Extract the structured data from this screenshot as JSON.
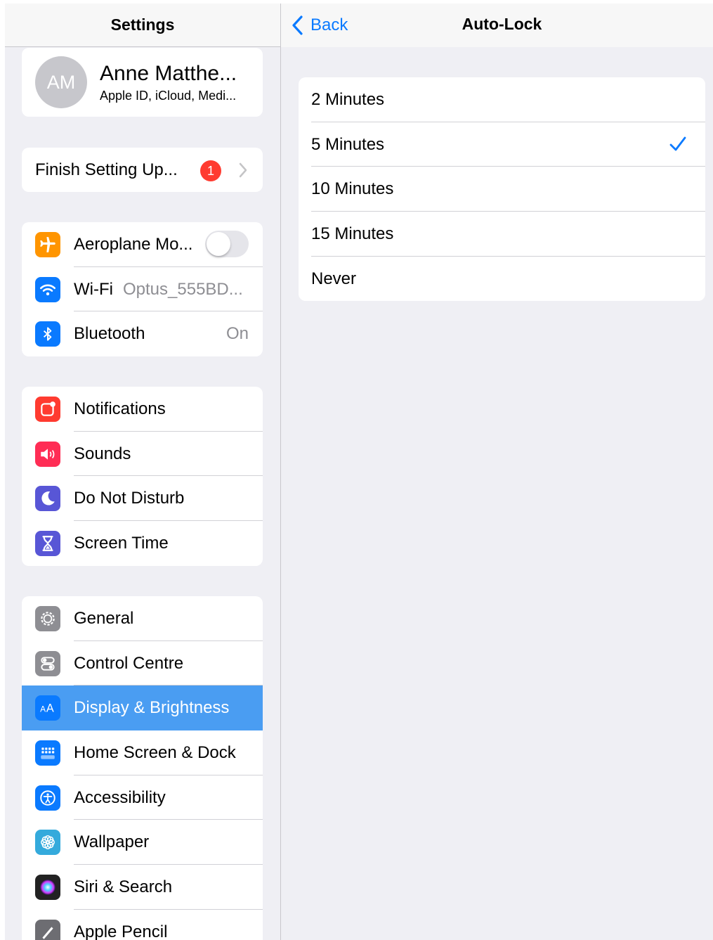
{
  "left": {
    "title": "Settings",
    "profile": {
      "initials": "AM",
      "name": "Anne Matthe...",
      "subtitle": "Apple ID, iCloud, Medi..."
    },
    "finish_setup": {
      "label": "Finish Setting Up...",
      "badge": "1"
    },
    "connectivity": [
      {
        "label": "Aeroplane Mo...",
        "icon": "airplane-icon",
        "color": "#ff9500",
        "toggle_on": false
      },
      {
        "label": "Wi-Fi",
        "value": "Optus_555BD...",
        "icon": "wifi-icon",
        "color": "#0a7aff"
      },
      {
        "label": "Bluetooth",
        "value": "On",
        "icon": "bluetooth-icon",
        "color": "#0a7aff"
      }
    ],
    "alerts": [
      {
        "label": "Notifications",
        "icon": "notifications-icon",
        "color": "#ff3b30"
      },
      {
        "label": "Sounds",
        "icon": "speaker-icon",
        "color": "#ff2d55"
      },
      {
        "label": "Do Not Disturb",
        "icon": "moon-icon",
        "color": "#5856d6"
      },
      {
        "label": "Screen Time",
        "icon": "hourglass-icon",
        "color": "#5856d6"
      }
    ],
    "system": [
      {
        "label": "General",
        "icon": "gear-icon",
        "color": "#8e8e93"
      },
      {
        "label": "Control Centre",
        "icon": "switches-icon",
        "color": "#8e8e93"
      },
      {
        "label": "Display & Brightness",
        "icon": "text-size-icon",
        "color": "#0a7aff",
        "selected": true
      },
      {
        "label": "Home Screen & Dock",
        "icon": "home-grid-icon",
        "color": "#0a7aff"
      },
      {
        "label": "Accessibility",
        "icon": "accessibility-icon",
        "color": "#0a7aff"
      },
      {
        "label": "Wallpaper",
        "icon": "flower-icon",
        "color": "#34aadc"
      },
      {
        "label": "Siri & Search",
        "icon": "siri-icon",
        "color": "#222222"
      },
      {
        "label": "Apple Pencil",
        "icon": "pencil-icon",
        "color": "#6d6d72"
      }
    ]
  },
  "right": {
    "back_label": "Back",
    "title": "Auto-Lock",
    "options": [
      {
        "label": "2 Minutes",
        "checked": false
      },
      {
        "label": "5 Minutes",
        "checked": true
      },
      {
        "label": "10 Minutes",
        "checked": false
      },
      {
        "label": "15 Minutes",
        "checked": false
      },
      {
        "label": "Never",
        "checked": false
      }
    ]
  },
  "colors": {
    "accent": "#0a7aff",
    "selection": "#4a9df2",
    "badge": "#ff3b30",
    "background": "#efeff4"
  }
}
